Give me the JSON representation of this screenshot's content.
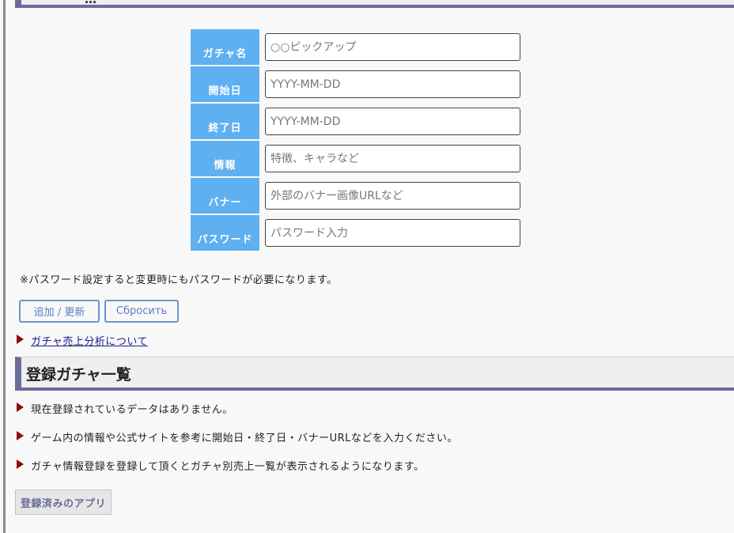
{
  "top_section": {
    "title": "…"
  },
  "form": {
    "rows": [
      {
        "label": "ガチャ名",
        "placeholder": "○○ピックアップ"
      },
      {
        "label": "開始日",
        "placeholder": "YYYY-MM-DD"
      },
      {
        "label": "終了日",
        "placeholder": "YYYY-MM-DD"
      },
      {
        "label": "情報",
        "placeholder": "特徴、キャラなど"
      },
      {
        "label": "バナー",
        "placeholder": "外部のバナー画像URLなど"
      },
      {
        "label": "パスワード",
        "placeholder": "パスワード入力"
      }
    ],
    "note": "※パスワード設定すると変更時にもパスワードが必要になります。",
    "add_button": "追加 / 更新",
    "reset_button": "Сбросить",
    "analysis_link": "ガチャ売上分析について"
  },
  "registered_section": {
    "title": "登録ガチャ一覧",
    "lines": [
      "現在登録されているデータはありません。",
      "ゲーム内の情報や公式サイトを参考に開始日・終了日・バナーURLなどを入力ください。",
      "ガチャ情報登録を登録して頂くとガチャ別売上一覧が表示されるようになります。"
    ],
    "apps_button": "登録済みのアプリ"
  },
  "colors": {
    "label_bg": "#5eb0f1",
    "heading_accent": "#6b6c9b",
    "bullet": "#8b0d0d",
    "button_border": "#6a95cf"
  }
}
